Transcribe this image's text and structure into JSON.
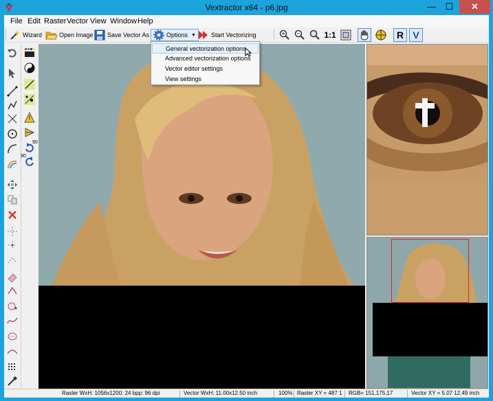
{
  "window": {
    "title": "Vextractor x64 - p6.jpg",
    "min_glyph": "—",
    "max_glyph": "☐",
    "close_glyph": "✕"
  },
  "menu": [
    "File",
    "Edit",
    "Raster",
    "Vector",
    "View",
    "Window",
    "Help"
  ],
  "toolbar": {
    "wizard": "Wizard",
    "open_image": "Open Image",
    "save_vector_as": "Save Vector As",
    "options": "Options",
    "start_vectorizing": "Start Vectorizing",
    "zoom_one_to_one": "1:1"
  },
  "options_menu": {
    "items": [
      "General vectorization options",
      "Advanced vectorization options",
      "Vector editor settings",
      "View settings"
    ],
    "highlighted_index": 0
  },
  "left_tools": {
    "rotate_90_label_a": "90",
    "rotate_90_label_b": "90"
  },
  "status": {
    "raster_size": "Raster WxH: 1056x1200: 24 bpp: 96 dpi",
    "vector_size": "Vector WxH: 11.00x12.50 inch",
    "zoom": "100%",
    "raster_xy": "Raster XY =  487   1",
    "rgb": "RGB= 151,175,17",
    "vector_xy": "Vector XY =  5.07 12.49 inch"
  },
  "colors": {
    "title_bar": "#1ca3dc",
    "close_button": "#c7504b",
    "menu_highlight": "#e5f1fb",
    "canvas_background": "#8aa3a7"
  }
}
